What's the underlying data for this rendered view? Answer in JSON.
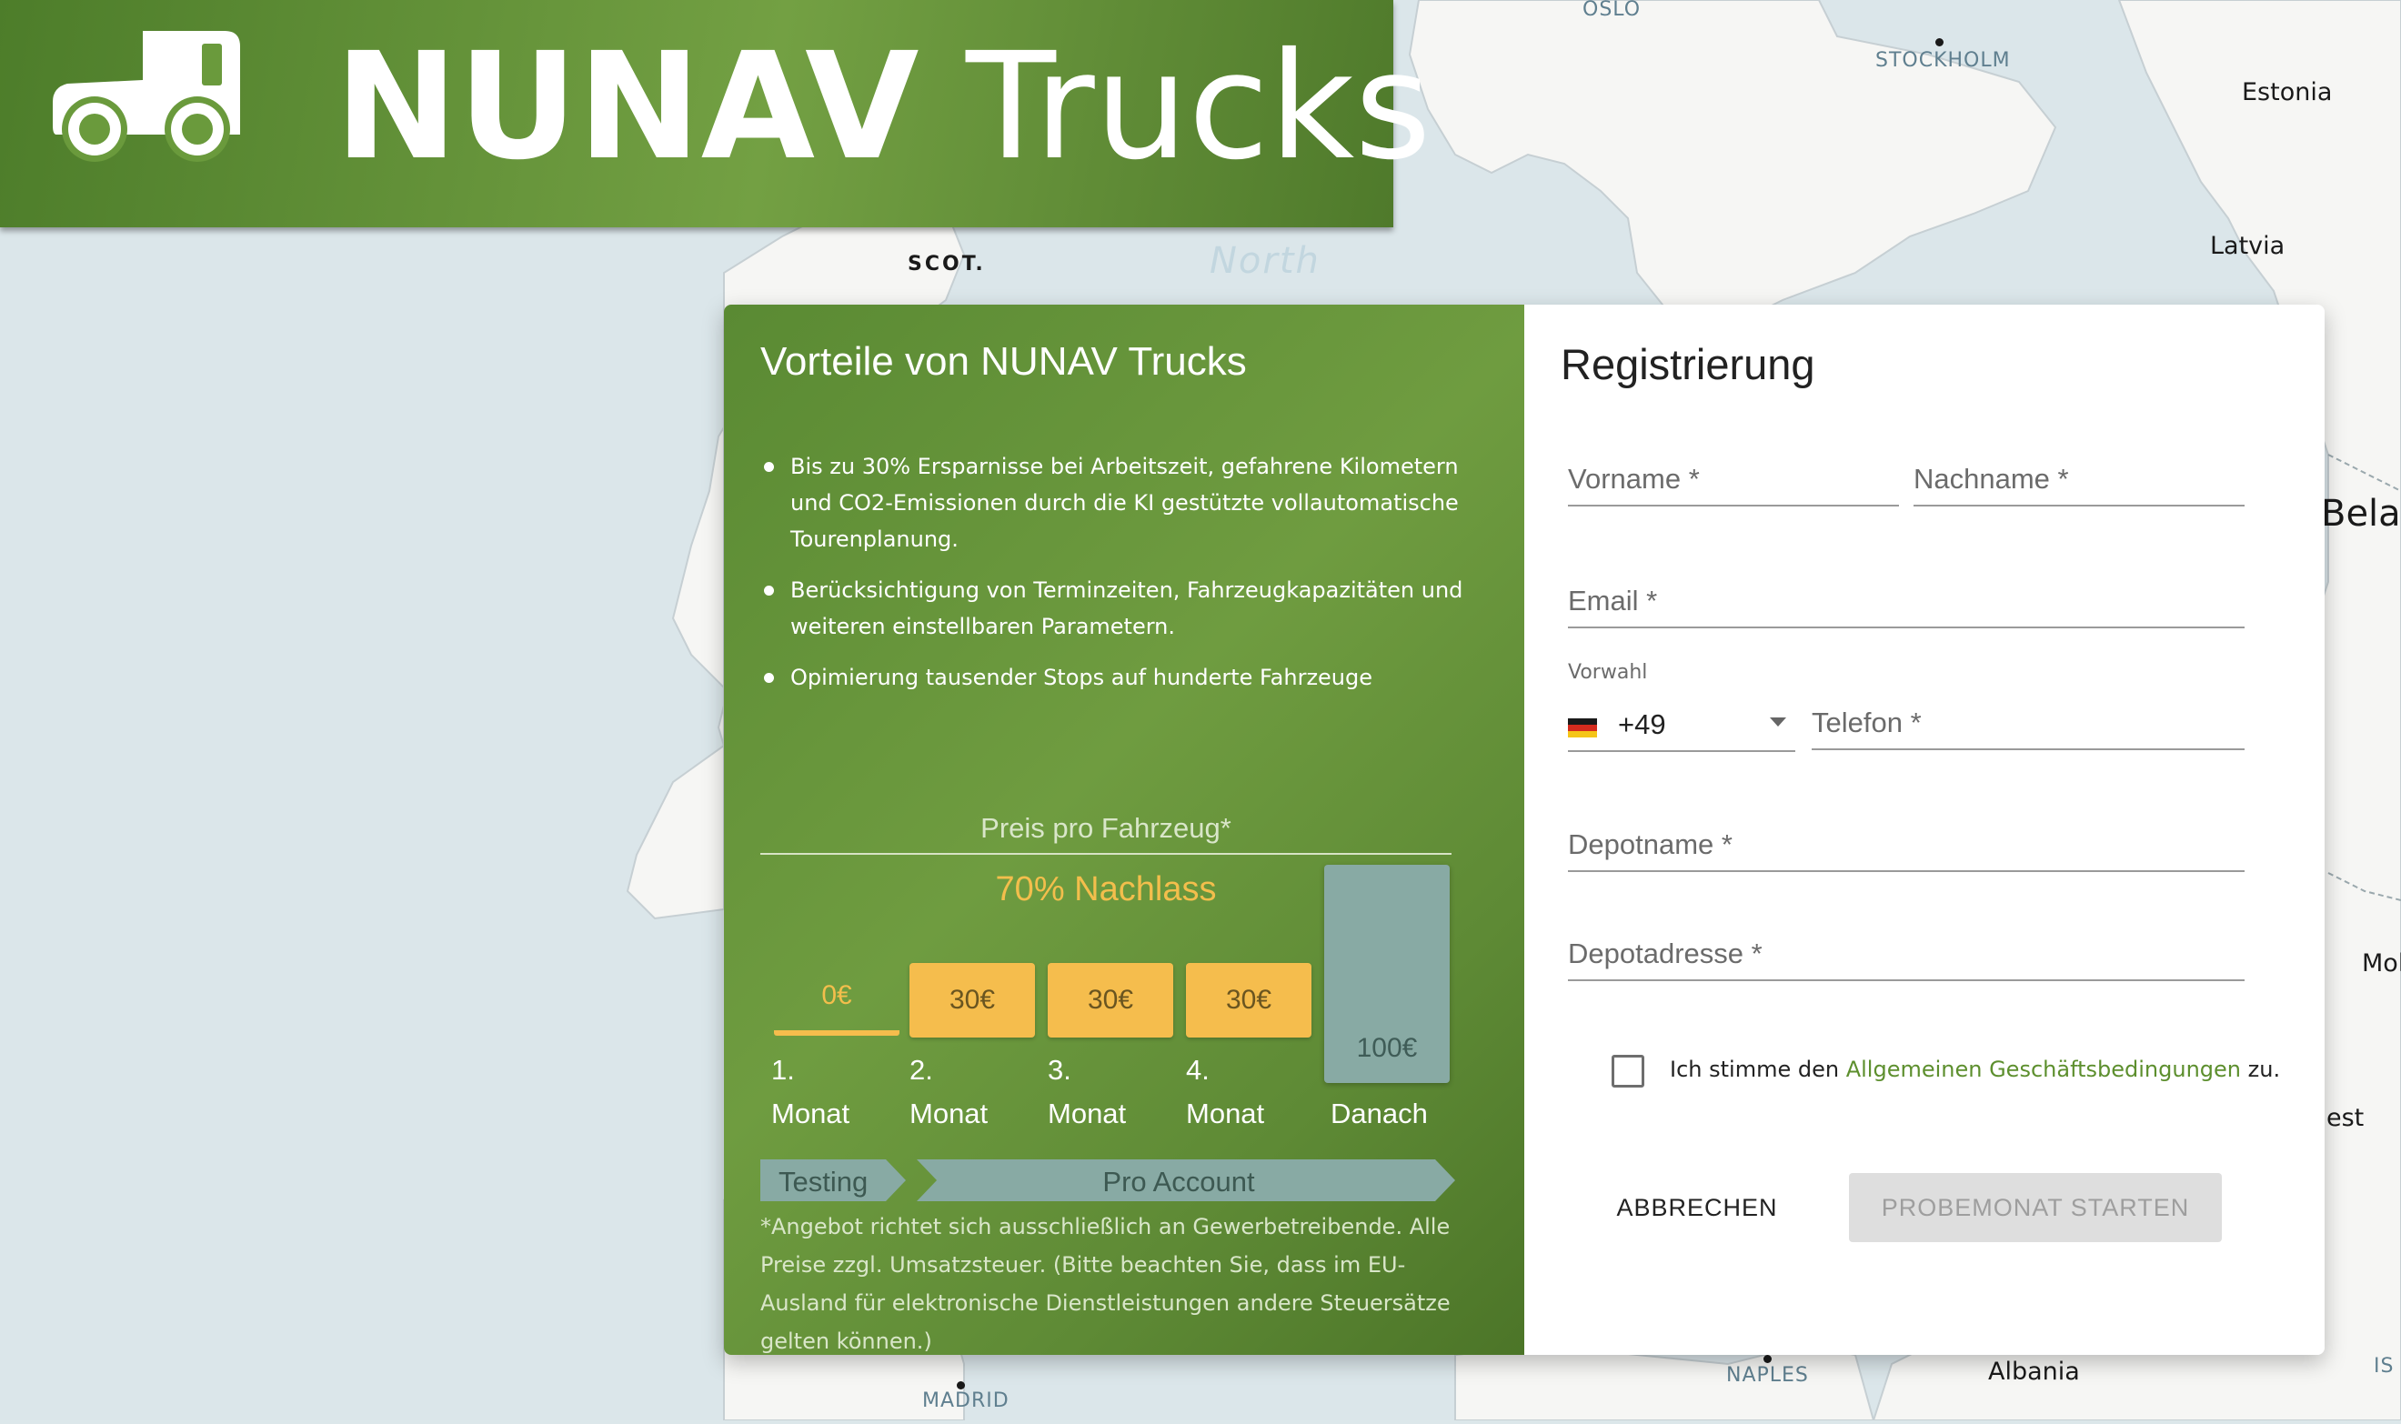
{
  "header": {
    "brand_bold": "NUNAV",
    "brand_rest": "Trucks"
  },
  "map": {
    "cities": [
      "OSLO",
      "STOCKHOLM",
      "NAPLES",
      "MADRID"
    ],
    "countries": [
      "Estonia",
      "Latvia",
      "Bela",
      "Mol",
      "Albania",
      "est",
      "IS"
    ],
    "regions": [
      "SCOT."
    ],
    "seas": [
      "North"
    ]
  },
  "benefits": {
    "title": "Vorteile von NUNAV Trucks",
    "items": [
      "Bis zu 30% Ersparnisse bei Arbeitszeit, gefahrene Kilometern und CO2-Emissionen durch die KI gestützte vollautomatische Tourenplanung.",
      "Berücksichtigung von Terminzeiten, Fahrzeugkapazitäten und weiteren einstellbaren Parametern.",
      "Opimierung tausender Stops auf hunderte Fahrzeuge"
    ],
    "price_caption": "Preis pro Fahrzeug*",
    "discount": "70% Nachlass",
    "prices": [
      {
        "value": "0€",
        "num": "1.",
        "label": "Monat"
      },
      {
        "value": "30€",
        "num": "2.",
        "label": "Monat"
      },
      {
        "value": "30€",
        "num": "3.",
        "label": "Monat"
      },
      {
        "value": "30€",
        "num": "4.",
        "label": "Monat"
      },
      {
        "value": "100€",
        "num": "",
        "label": "Danach"
      }
    ],
    "plan_testing": "Testing",
    "plan_pro": "Pro Account",
    "disclaimer": "*Angebot richtet sich ausschließlich an Gewerbetreibende. Alle Preise zzgl. Umsatzsteuer. (Bitte beachten Sie, dass im EU-Ausland für elektronische Dienstleistungen andere Steuersätze gelten können.)"
  },
  "registration": {
    "title": "Registrierung",
    "first_name": {
      "label": "Vorname *",
      "value": ""
    },
    "last_name": {
      "label": "Nachname *",
      "value": ""
    },
    "email": {
      "label": "Email *",
      "value": ""
    },
    "prefix": {
      "label": "Vorwahl",
      "value": "+49",
      "flag": "de-flag-icon"
    },
    "phone": {
      "label": "Telefon *",
      "value": ""
    },
    "depot_name": {
      "label": "Depotname *",
      "value": ""
    },
    "depot_address": {
      "label": "Depotadresse *",
      "value": ""
    },
    "terms_checked": false,
    "terms_pre": "Ich stimme den",
    "terms_link": "Allgemeinen Geschäftsbedingungen",
    "terms_post": "zu.",
    "cancel_label": "ABBRECHEN",
    "start_label": "PROBEMONAT STARTEN"
  },
  "colors": {
    "brand_green": "#6a9a3c",
    "accent_yellow": "#f5bd4d",
    "pro_teal": "#88aaa4",
    "link_green": "#5d8f2e"
  }
}
